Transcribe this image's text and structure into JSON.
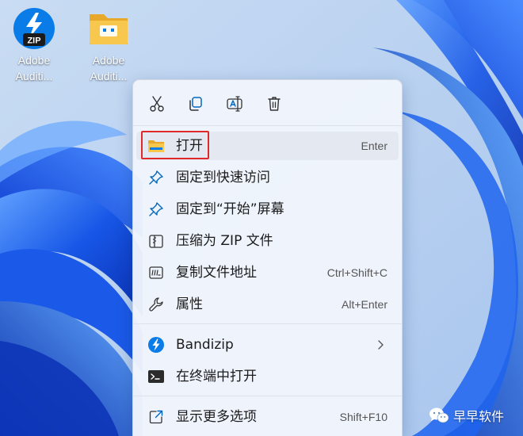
{
  "desktop": {
    "icons": [
      {
        "label_line1": "Adobe",
        "label_line2": "Auditi...",
        "icon": "zip-archive-icon"
      },
      {
        "label_line1": "Adobe",
        "label_line2": "Auditi...",
        "icon": "folder-icon"
      }
    ],
    "zip_badge": "ZIP"
  },
  "context_menu": {
    "quick_actions": [
      {
        "icon": "cut-icon"
      },
      {
        "icon": "copy-icon"
      },
      {
        "icon": "rename-icon"
      },
      {
        "icon": "delete-icon"
      }
    ],
    "items": [
      {
        "label": "打开",
        "shortcut": "Enter",
        "icon": "folder-open-icon",
        "highlighted": true
      },
      {
        "label": "固定到快速访问",
        "shortcut": "",
        "icon": "pin-icon"
      },
      {
        "label": "固定到“开始”屏幕",
        "shortcut": "",
        "icon": "pin-icon"
      },
      {
        "label": "压缩为 ZIP 文件",
        "shortcut": "",
        "icon": "zip-file-icon"
      },
      {
        "label": "复制文件地址",
        "shortcut": "Ctrl+Shift+C",
        "icon": "copy-path-icon"
      },
      {
        "label": "属性",
        "shortcut": "Alt+Enter",
        "icon": "wrench-icon"
      },
      {
        "label": "Bandizip",
        "shortcut": "",
        "icon": "bandizip-icon",
        "submenu": true
      },
      {
        "label": "在终端中打开",
        "shortcut": "",
        "icon": "terminal-icon"
      },
      {
        "label": "显示更多选项",
        "shortcut": "Shift+F10",
        "icon": "show-more-icon"
      }
    ]
  },
  "watermark": {
    "text": "早早软件",
    "icon": "wechat-icon"
  },
  "colors": {
    "accent": "#0067c0",
    "highlight_border": "#e02a2a",
    "folder": "#f5c242",
    "wallpaper_blue": "#1a5fe0"
  }
}
